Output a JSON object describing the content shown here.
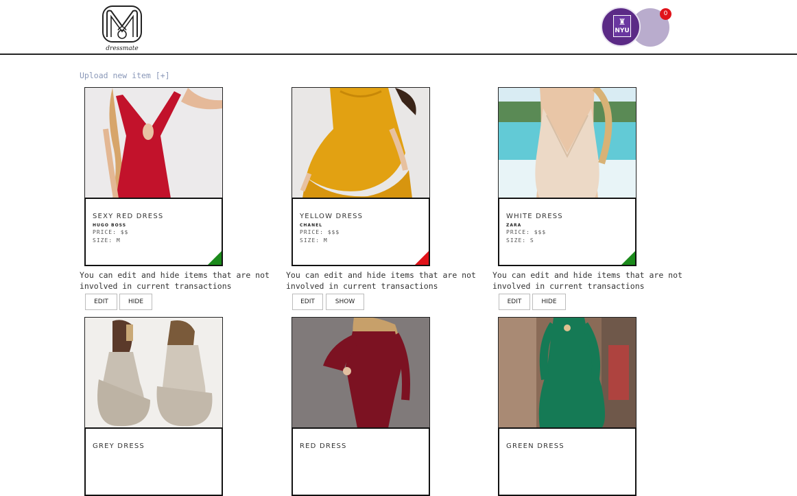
{
  "header": {
    "logo_text": "dressmate",
    "profile_badge": "NYU",
    "notifications_count": "0"
  },
  "upload_link": "Upload new item [+]",
  "items": [
    {
      "title": "SEXY RED DRESS",
      "brand": "HUGO BOSS",
      "price": "PRICE: $$",
      "size": "SIZE: M",
      "status_color": "#1b8a1b",
      "note": "You can edit and hide items that are not involved in current transactions",
      "edit_label": "EDIT",
      "toggle_label": "HIDE"
    },
    {
      "title": "YELLOW DRESS",
      "brand": "CHANEL",
      "price": "PRICE: $$$",
      "size": "SIZE: M",
      "status_color": "#e0131a",
      "note": "You can edit and hide items that are not involved in current transactions",
      "edit_label": "EDIT",
      "toggle_label": "SHOW"
    },
    {
      "title": "WHITE DRESS",
      "brand": "ZARA",
      "price": "PRICE: $$$",
      "size": "SIZE: S",
      "status_color": "#1b8a1b",
      "note": "You can edit and hide items that are not involved in current transactions",
      "edit_label": "EDIT",
      "toggle_label": "HIDE"
    },
    {
      "title": "GREY DRESS"
    },
    {
      "title": "RED DRESS"
    },
    {
      "title": "GREEN DRESS"
    }
  ]
}
